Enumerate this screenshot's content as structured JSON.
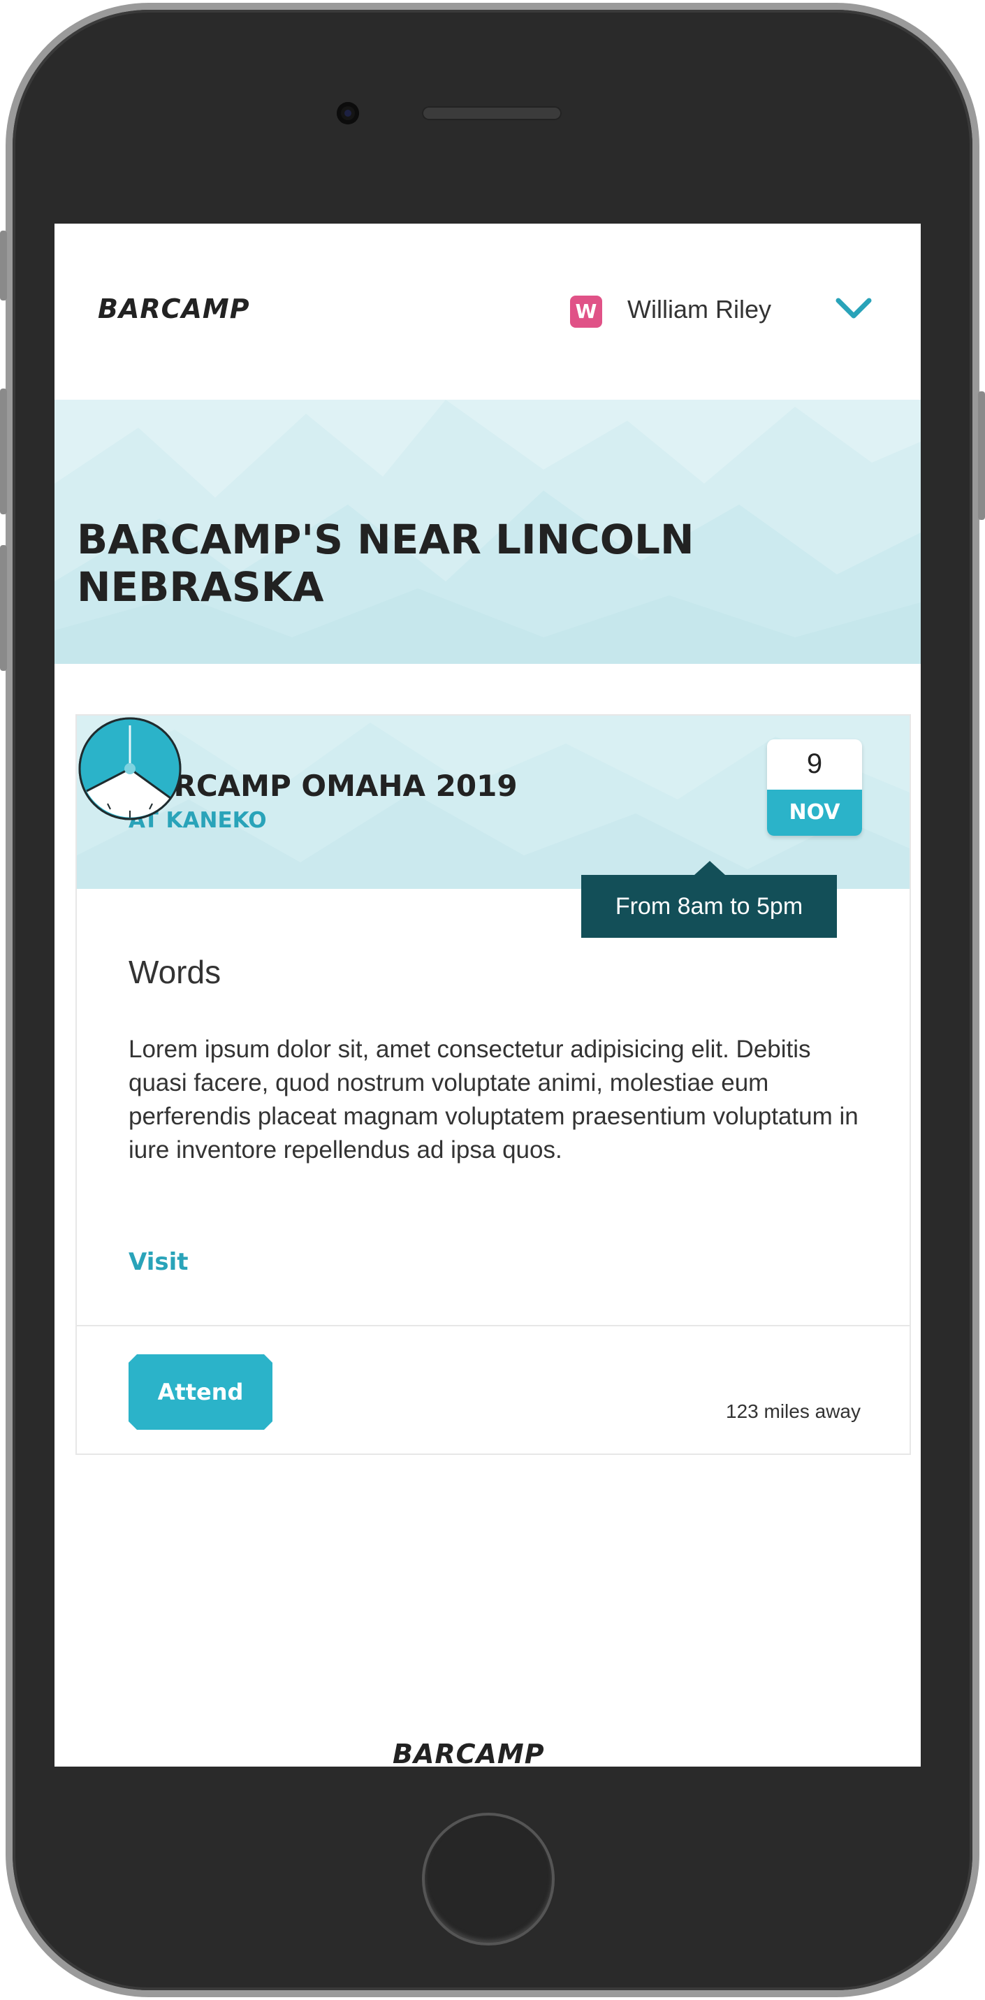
{
  "header": {
    "brand": "BARCAMP",
    "user_initial": "W",
    "user_name": "William Riley",
    "dropdown_icon": "chevron-down-icon"
  },
  "hero": {
    "title": "BARCAMP'S NEAR LINCOLN NEBRASKA"
  },
  "event": {
    "title": "BARCAMP OMAHA 2019",
    "venue": "AT KANEKO",
    "date_day": "9",
    "date_month": "NOV",
    "time_tooltip": "From 8am to 5pm",
    "section_heading": "Words",
    "description": "Lorem ipsum dolor sit, amet consectetur adipisicing elit. Debitis quasi facere, quod nostrum voluptate animi, molestiae eum perferendis placeat magnam voluptatem praesentium voluptatum in iure inventore repellendus ad ipsa quos.",
    "visit_label": "Visit",
    "attend_label": "Attend",
    "distance": "123 miles away"
  },
  "footer": {
    "brand": "BARCAMP"
  },
  "colors": {
    "accent": "#2bb3c9",
    "tooltip_bg": "#134f58",
    "avatar_bg": "#e05287",
    "hero_bg": "#dff2f5"
  }
}
